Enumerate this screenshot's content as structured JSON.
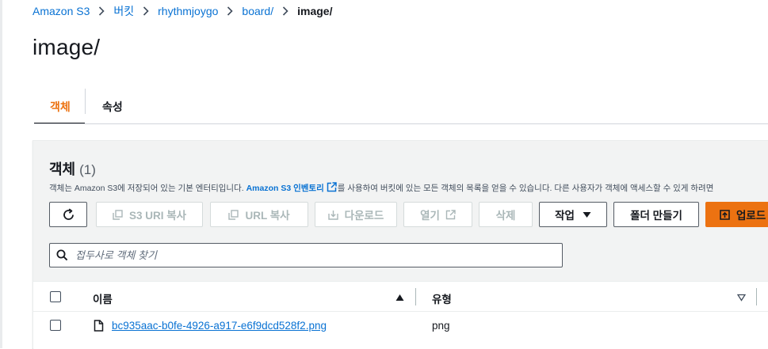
{
  "breadcrumb": {
    "items": [
      "Amazon S3",
      "버킷",
      "rhythmjoygo",
      "board/"
    ],
    "current": "image/"
  },
  "page": {
    "title": "image/"
  },
  "tabs": [
    {
      "label": "객체",
      "active": true
    },
    {
      "label": "속성",
      "active": false
    }
  ],
  "panel": {
    "title": "객체",
    "count": "(1)",
    "description_prefix": "객체는 Amazon S3에 저장되어 있는 기본 엔터티입니다.",
    "description_link": "Amazon S3 인벤토리",
    "description_suffix": "를 사용하여 버킷에 있는 모든 객체의 목록을 얻을 수 있습니다. 다른 사용자가 객체에 액세스할 수 있게 하려면"
  },
  "toolbar": {
    "refresh_icon": "refresh-icon",
    "copy_s3_uri": "S3 URI 복사",
    "copy_url": "URL 복사",
    "download": "다운로드",
    "open": "열기",
    "delete": "삭제",
    "actions": "작업",
    "create_folder": "폴더 만들기",
    "upload": "업로드"
  },
  "search": {
    "placeholder": "접두사로 객체 찾기",
    "value": ""
  },
  "table": {
    "columns": [
      "이름",
      "유형"
    ],
    "rows": [
      {
        "name": "bc935aac-b0fe-4926-a917-e6f9dcd528f2.png",
        "type": "png"
      }
    ]
  },
  "colors": {
    "accent": "#ec7211",
    "link": "#0972d3",
    "text": "#16191f",
    "disabled": "#aab7b8"
  }
}
